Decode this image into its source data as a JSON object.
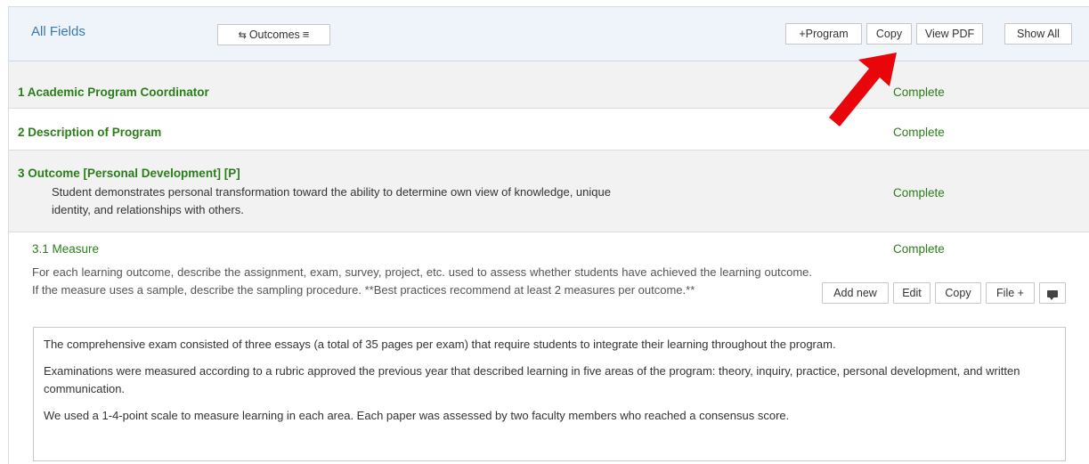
{
  "header": {
    "all_fields_label": "All Fields",
    "outcomes_label": "Outcomes",
    "outcomes_left_icon": "swap-arrows-icon",
    "outcomes_right_icon": "hamburger-icon",
    "buttons": {
      "program": "+Program",
      "copy": "Copy",
      "view_pdf": "View PDF",
      "show_all": "Show All"
    }
  },
  "rows": [
    {
      "title": "1 Academic Program Coordinator",
      "status": "Complete"
    },
    {
      "title": "2 Description of Program",
      "status": "Complete"
    },
    {
      "title": "3 Outcome [Personal Development] [P]",
      "status": "Complete",
      "description": "Student demonstrates personal transformation toward the ability to determine own view of knowledge, unique identity, and relationships with others."
    }
  ],
  "measure": {
    "title": "3.1 Measure",
    "status": "Complete",
    "description": "For each learning outcome, describe the assignment, exam, survey, project, etc. used to assess whether students have achieved the learning outcome. If the measure uses a sample, describe the sampling procedure. **Best practices recommend at least 2 measures per outcome.**",
    "buttons": {
      "add_new": "Add new",
      "edit": "Edit",
      "copy": "Copy",
      "file": "File +"
    },
    "comment_icon": "comment-icon",
    "content": [
      "The comprehensive exam consisted of three essays (a total of 35 pages per exam) that require students to integrate their learning throughout the program.",
      "Examinations were measured according to a rubric approved the previous year that described learning in five areas of the program: theory, inquiry, practice, personal development, and written communication.",
      "We used a 1-4-point scale to measure learning in each area. Each paper was assessed by two faculty members who reached a consensus score."
    ]
  },
  "colors": {
    "accent_green": "#2a7e19",
    "link_blue": "#3a78b6",
    "arrow_red": "#e8060b",
    "header_bg": "#eef4f9"
  },
  "annotation_icon": "red-arrow-icon"
}
